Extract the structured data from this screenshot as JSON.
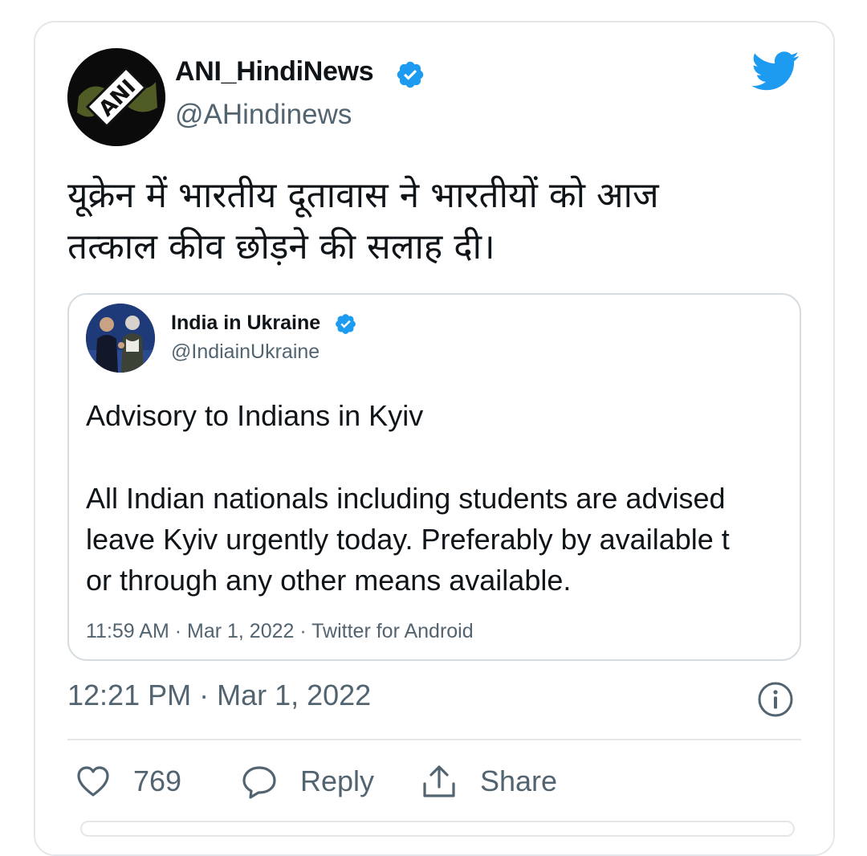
{
  "tweet": {
    "author_name": "ANI_HindiNews",
    "author_handle": "@AHindinews",
    "avatar_text": "ANI",
    "text_line1": "यूक्रेन में भारतीय दूतावास ने भारतीयों को आज",
    "text_line2": "तत्काल कीव छोड़ने की सलाह दी।",
    "timestamp": "12:21 PM · Mar 1, 2022",
    "likes": "769",
    "reply_label": "Reply",
    "share_label": "Share"
  },
  "quoted": {
    "author_name": "India in Ukraine",
    "author_handle": "@IndiainUkraine",
    "title": "Advisory to Indians in Kyiv",
    "body_line1": "All Indian nationals including students are advised",
    "body_line2": "leave Kyiv urgently today. Preferably by available t",
    "body_line3": "or through any other means available.",
    "meta": "11:59 AM · Mar 1, 2022 · Twitter for Android"
  },
  "colors": {
    "accent": "#1d9bf0",
    "text": "#0f1419",
    "secondary": "#536471",
    "border": "#e4e7ea"
  },
  "icons": [
    "twitter-bird-icon",
    "verified-badge-icon",
    "info-icon",
    "heart-icon",
    "reply-icon",
    "share-icon"
  ]
}
